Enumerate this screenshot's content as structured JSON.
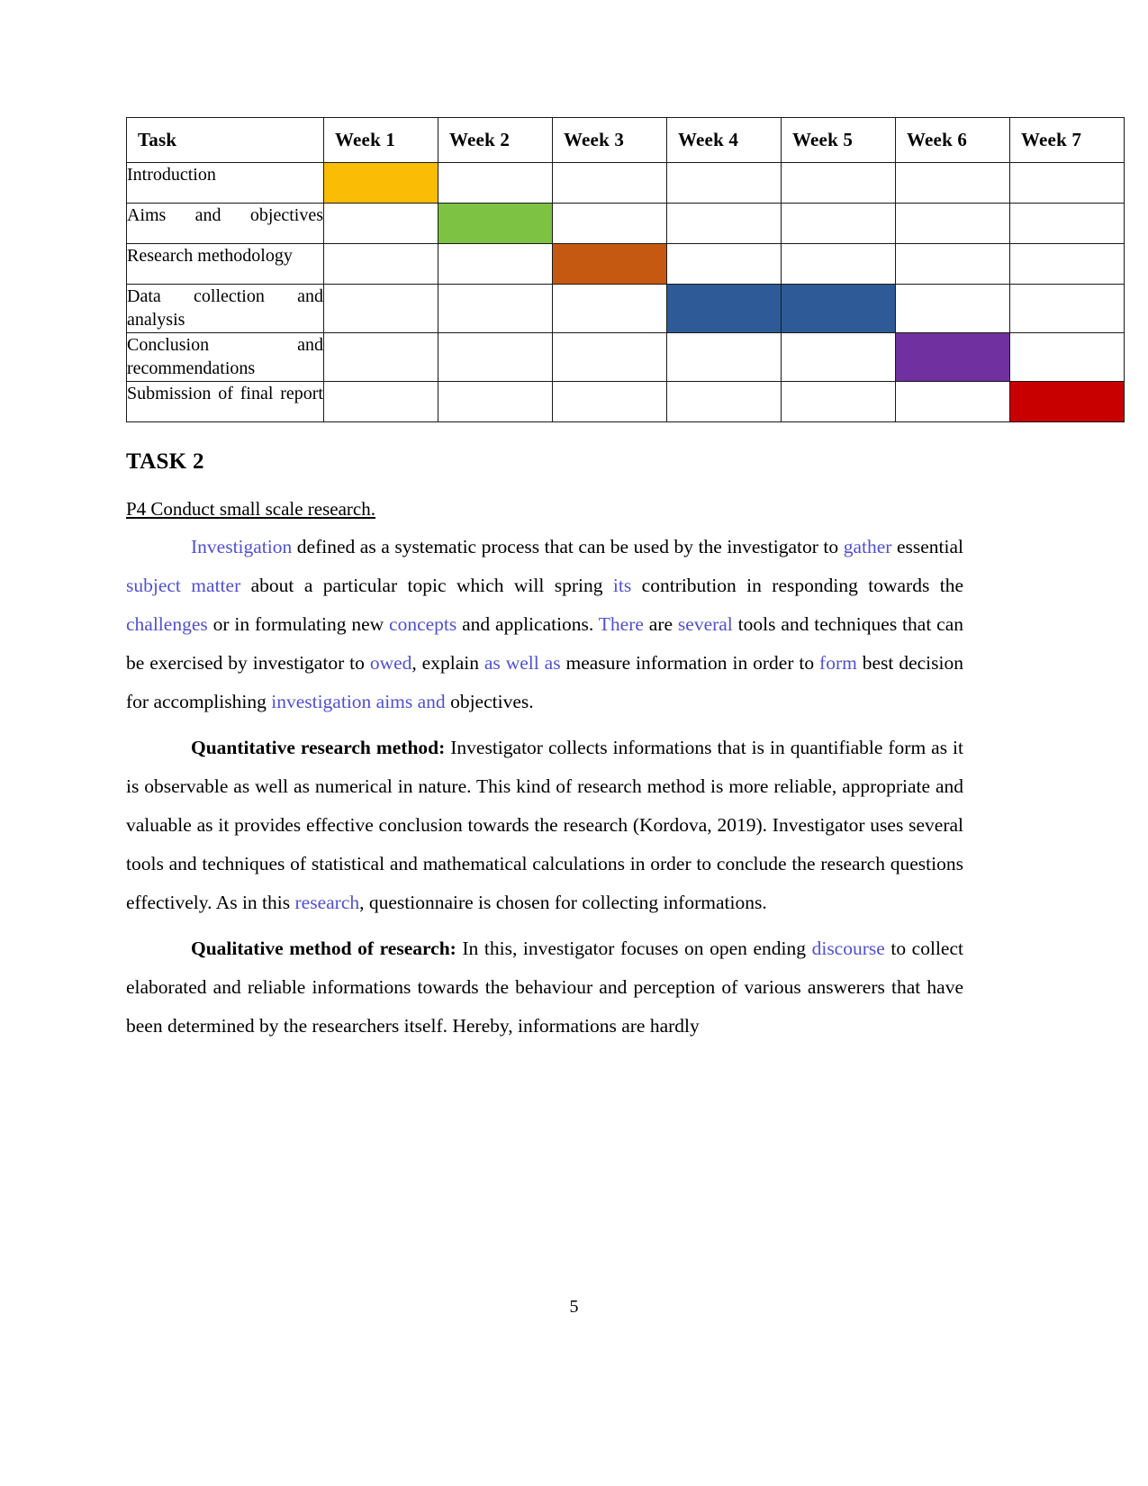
{
  "gantt": {
    "columns": [
      "Task",
      "Week 1",
      "Week 2",
      "Week 3",
      "Week 4",
      "Week 5",
      "Week 6",
      "Week 7"
    ],
    "rows": [
      {
        "task": "Introduction",
        "filled": [
          1
        ],
        "color": "#FBBC05",
        "color_name": "yellow"
      },
      {
        "task": "Aims and objectives",
        "filled": [
          2
        ],
        "color": "#7DC242",
        "color_name": "green"
      },
      {
        "task": "Research methodology",
        "filled": [
          3
        ],
        "color": "#C65911",
        "color_name": "orange"
      },
      {
        "task": "Data collection and analysis",
        "filled": [
          4,
          5
        ],
        "color": "#2E5B97",
        "color_name": "blue"
      },
      {
        "task": "Conclusion and recommendations",
        "filled": [
          6
        ],
        "color": "#7030A0",
        "color_name": "purple"
      },
      {
        "task": "Submission of final report",
        "filled": [
          7
        ],
        "color": "#C80000",
        "color_name": "red"
      }
    ]
  },
  "task_title": "TASK 2",
  "subhead": "P4 Conduct small scale research.",
  "paragraphs": {
    "p1": {
      "s1": "Investigation",
      "s2": " defined as a systematic process that can be used by the investigator to ",
      "s3": "gather",
      "s4": " essential ",
      "s5": "subject matter",
      "s6": " about a particular topic which will spring ",
      "s7": "its",
      "s8": " contribution in responding towards the ",
      "s9": "challenges",
      "s10": " or in formulating new ",
      "s11": "concepts",
      "s12": " and applications. ",
      "s13": "There",
      "s14": " are ",
      "s15": "several",
      "s16": " tools and techniques that can be exercised by investigator to ",
      "s17": "owed",
      "s18": ", explain ",
      "s19": "as well as",
      "s20": " measure information in order to ",
      "s21": "form",
      "s22": " best decision for accomplishing ",
      "s23": "investigation aims and",
      "s24": " objectives."
    },
    "p2": {
      "s1": "Quantitative research method:",
      "s2": " Investigator collects informations that is in quantifiable form as it is observable as well as numerical in nature. This kind of research method is more reliable, appropriate and valuable as it provides effective conclusion towards the research (Kordova, 2019). Investigator uses several tools and techniques of statistical and mathematical calculations in order to conclude the research questions effectively. As in this ",
      "s3": "research",
      "s4": ", questionnaire is chosen for collecting informations."
    },
    "p3": {
      "s1": "Qualitative method of research:",
      "s2": " In this, investigator focuses on open ending ",
      "s3": "discourse",
      "s4": " to collect elaborated and reliable informations towards the behaviour and perception of various answerers that have been determined by the researchers itself. Hereby, informations are hardly"
    }
  },
  "page_number": "5",
  "colors": {
    "highlight_text": "#5050d2",
    "body_text": "#000000",
    "table_border": "#1a1a1a"
  }
}
